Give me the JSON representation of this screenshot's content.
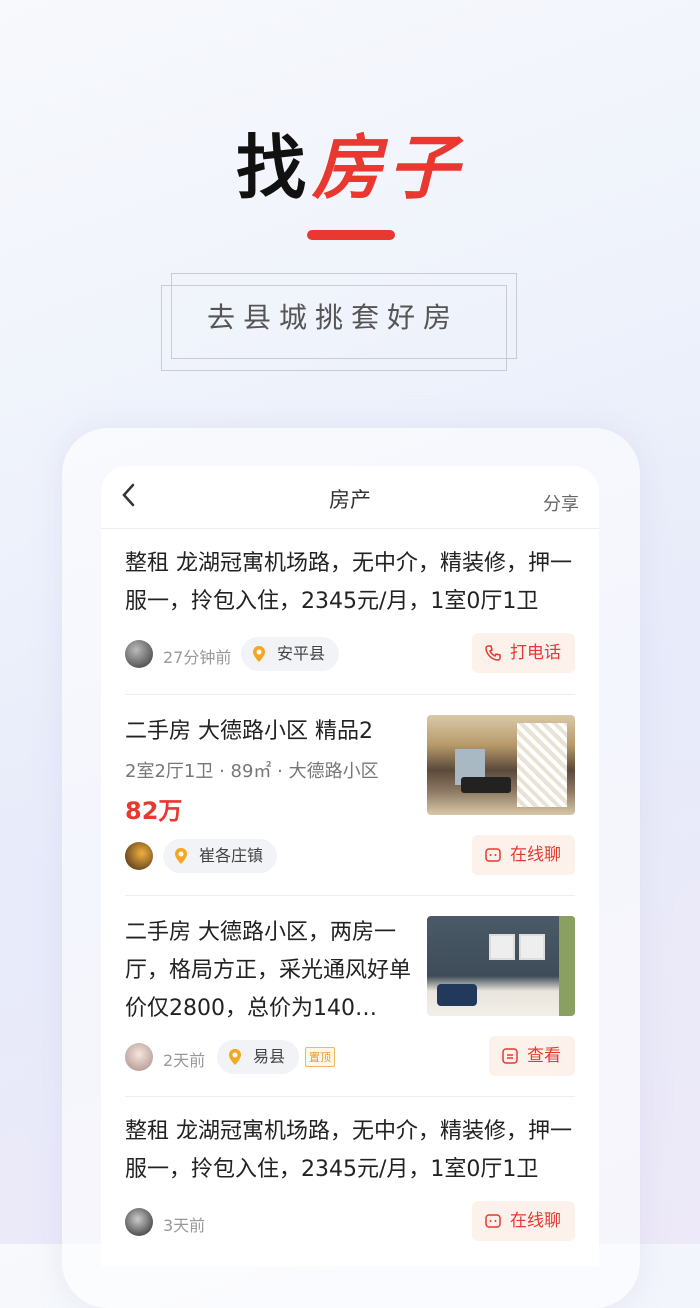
{
  "hero": {
    "title_black": "找",
    "title_red": "房子",
    "slogan": "去县城挑套好房"
  },
  "topbar": {
    "title": "房产",
    "share": "分享"
  },
  "colors": {
    "accent": "#e8382f",
    "price": "#e8382f"
  },
  "listings": [
    {
      "text": "整租 龙湖冠寓机场路，无中介，精装修，押一服一，拎包入住，2345元/月，1室0厅1卫",
      "time": "27分钟前",
      "location": "安平县",
      "action": "打电话",
      "action_icon": "phone-icon"
    },
    {
      "text": "二手房 大德路小区 精品2",
      "details": "2室2厅1卫 · 89㎡ · 大德路小区",
      "price": "82万",
      "location": "崔各庄镇",
      "action": "在线聊",
      "action_icon": "chat-icon"
    },
    {
      "text": "二手房 大德路小区，两房一厅，格局方正，采光通风好单价仅2800，总价为140…",
      "time": "2天前",
      "location": "易县",
      "tag": "置顶",
      "action": "查看",
      "action_icon": "doc-icon"
    },
    {
      "text": "整租 龙湖冠寓机场路，无中介，精装修，押一服一，拎包入住，2345元/月，1室0厅1卫",
      "time": "3天前",
      "action": "在线聊",
      "action_icon": "chat-icon"
    }
  ]
}
